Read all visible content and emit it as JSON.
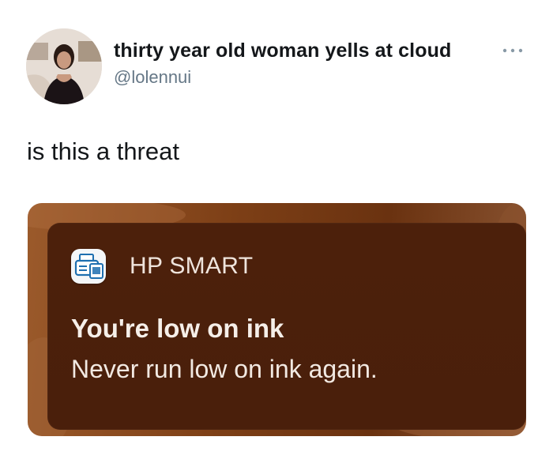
{
  "tweet": {
    "display_name": "thirty year old woman yells at cloud",
    "handle": "@lolennui",
    "text": "is this a threat"
  },
  "notification": {
    "app_name": "HP SMART",
    "title": "You're low on ink",
    "body": "Never run low on ink again."
  },
  "icons": {
    "avatar": "profile-photo",
    "more": "more-options-icon",
    "app": "hp-smart-printer-icon"
  },
  "colors": {
    "name": "#14171a",
    "handle": "#657786",
    "card_wallpaper": "#7d3f16",
    "notification_bg": "#4a1f0b",
    "notification_text": "#f6efe9"
  }
}
